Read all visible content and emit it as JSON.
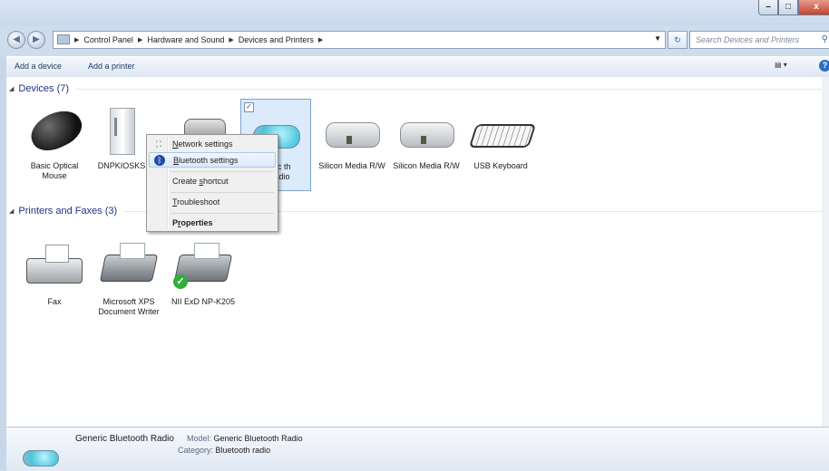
{
  "titlebar": {
    "min_glyph": "–",
    "max_glyph": "□",
    "close_glyph": "x"
  },
  "nav": {
    "back_glyph": "◀",
    "forward_glyph": "▶",
    "breadcrumbs": [
      "Control Panel",
      "Hardware and Sound",
      "Devices and Printers"
    ],
    "refresh_glyph": "↻",
    "search_placeholder": "Search Devices and Printers",
    "search_glyph": "⚲"
  },
  "toolbar": {
    "add_device": "Add a device",
    "add_printer": "Add a printer",
    "view_glyph": "▤ ▾",
    "help_glyph": "?"
  },
  "devices_group": {
    "header": "Devices (7)",
    "items": [
      {
        "label": "Basic Optical Mouse",
        "icon": "mouse-icon"
      },
      {
        "label": "DNPKIOSKS",
        "icon": "computer-tower-icon"
      },
      {
        "label": "",
        "icon": "device-icon"
      },
      {
        "label": "eric th Radio",
        "icon": "bluetooth-radio-icon",
        "selected": true
      },
      {
        "label": "Silicon Media R/W",
        "icon": "drive-icon"
      },
      {
        "label": "Silicon Media R/W",
        "icon": "drive-icon"
      },
      {
        "label": "USB Keyboard",
        "icon": "keyboard-icon"
      }
    ]
  },
  "printers_group": {
    "header": "Printers and Faxes (3)",
    "items": [
      {
        "label": "Fax",
        "icon": "fax-icon"
      },
      {
        "label": "Microsoft XPS Document Writer",
        "icon": "printer-icon"
      },
      {
        "label": "NII ExD NP-K205",
        "icon": "printer-icon",
        "default": true
      }
    ]
  },
  "context_menu": {
    "items": [
      {
        "label": "Network settings",
        "icon": "network-icon"
      },
      {
        "label": "Bluetooth settings",
        "icon": "bluetooth-icon",
        "highlighted": true
      },
      {
        "label": "Create shortcut"
      },
      {
        "label": "Troubleshoot"
      },
      {
        "label": "Properties",
        "bold": true
      }
    ]
  },
  "details": {
    "name": "Generic Bluetooth Radio",
    "model_key": "Model:",
    "model_value": "Generic Bluetooth Radio",
    "category_key": "Category:",
    "category_value": "Bluetooth radio"
  }
}
